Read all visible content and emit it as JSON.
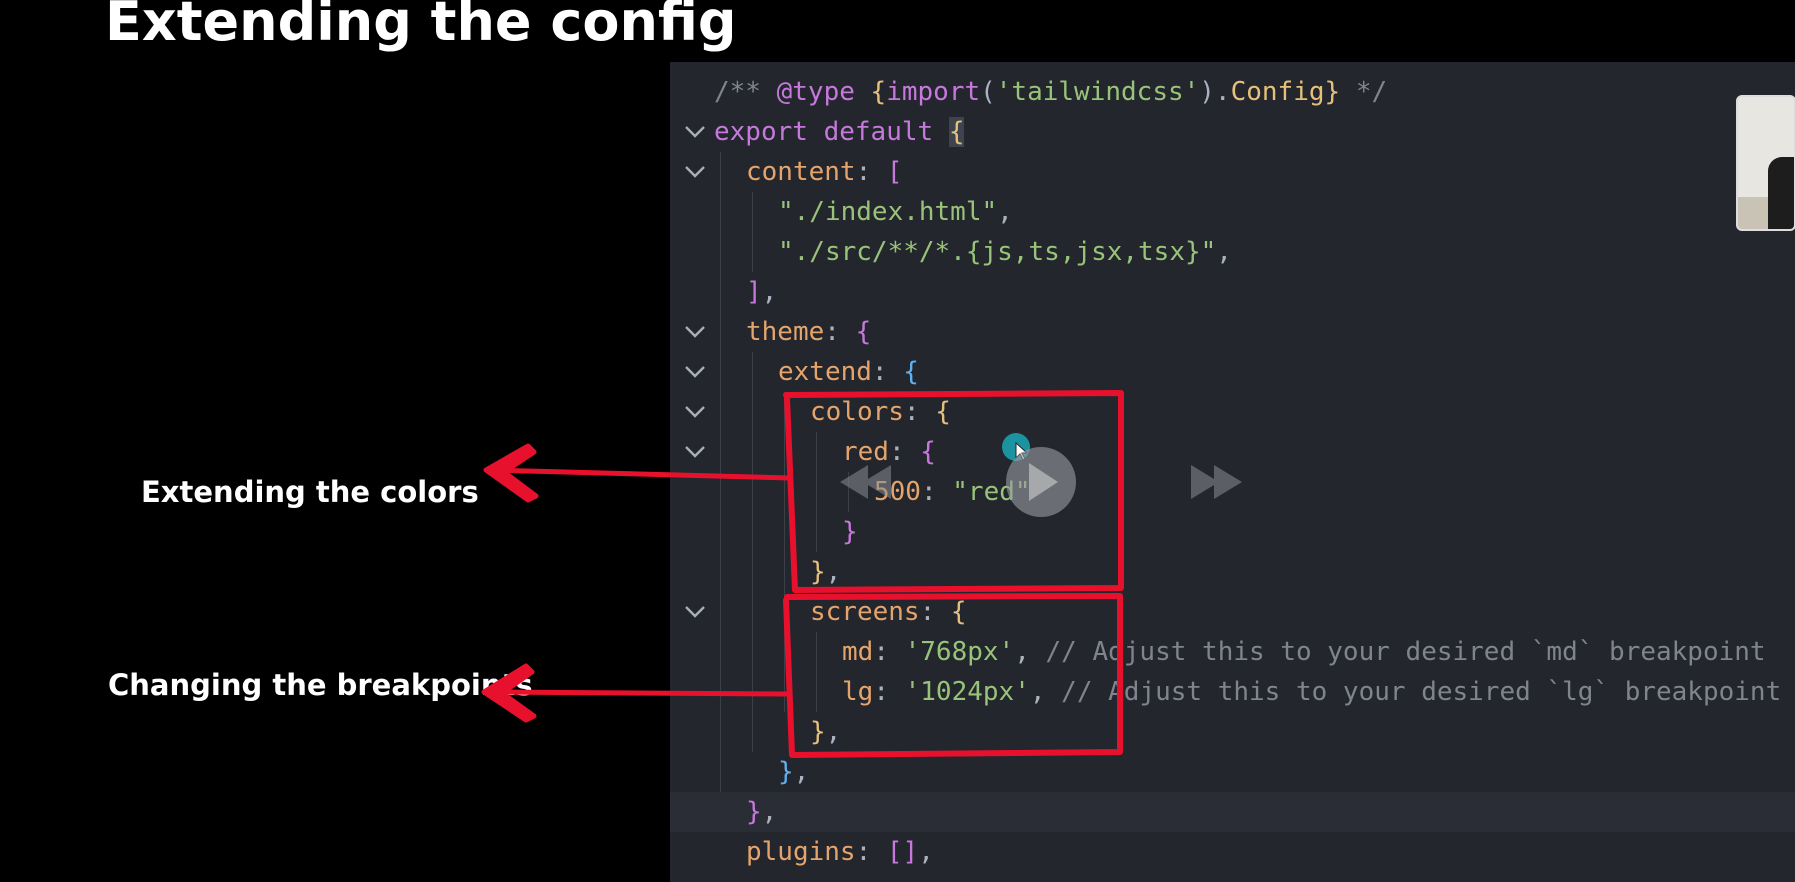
{
  "slide": {
    "title": "Extending the config",
    "annotations": {
      "colors": "Extending the colors",
      "breakpoints": "Changing the breakpoints"
    }
  },
  "editor": {
    "lines": [
      {
        "tokens": [
          {
            "t": "/** ",
            "c": "c-com"
          },
          {
            "t": "@type ",
            "c": "c-kw"
          },
          {
            "t": "{",
            "c": "c-brk-y"
          },
          {
            "t": "import",
            "c": "c-kw"
          },
          {
            "t": "(",
            "c": "c-pun"
          },
          {
            "t": "'tailwindcss'",
            "c": "c-str"
          },
          {
            "t": ").",
            "c": "c-pun"
          },
          {
            "t": "Config",
            "c": "c-fn"
          },
          {
            "t": "}",
            "c": "c-brk-y"
          },
          {
            "t": " */",
            "c": "c-com"
          }
        ]
      },
      {
        "fold": true,
        "tokens": [
          {
            "t": "export ",
            "c": "c-kw"
          },
          {
            "t": "default ",
            "c": "c-kw"
          },
          {
            "t": "{",
            "c": "c-brk-y brace-hl"
          }
        ]
      },
      {
        "fold": true,
        "tokens": [
          {
            "t": "content",
            "c": "c-key"
          },
          {
            "t": ": ",
            "c": "c-pun"
          },
          {
            "t": "[",
            "c": "c-brk-p"
          }
        ]
      },
      {
        "tokens": [
          {
            "t": "\"./index.html\"",
            "c": "c-str"
          },
          {
            "t": ",",
            "c": "c-pun"
          }
        ]
      },
      {
        "tokens": [
          {
            "t": "\"./src/**/*.{js,ts,jsx,tsx}\"",
            "c": "c-str"
          },
          {
            "t": ",",
            "c": "c-pun"
          }
        ]
      },
      {
        "tokens": [
          {
            "t": "]",
            "c": "c-brk-p"
          },
          {
            "t": ",",
            "c": "c-pun"
          }
        ]
      },
      {
        "fold": true,
        "tokens": [
          {
            "t": "theme",
            "c": "c-key"
          },
          {
            "t": ": ",
            "c": "c-pun"
          },
          {
            "t": "{",
            "c": "c-brk-p"
          }
        ]
      },
      {
        "fold": true,
        "tokens": [
          {
            "t": "extend",
            "c": "c-key"
          },
          {
            "t": ": ",
            "c": "c-pun"
          },
          {
            "t": "{",
            "c": "c-brk-b"
          }
        ]
      },
      {
        "fold": true,
        "tokens": [
          {
            "t": "colors",
            "c": "c-key"
          },
          {
            "t": ": ",
            "c": "c-pun"
          },
          {
            "t": "{",
            "c": "c-brk-y"
          }
        ]
      },
      {
        "fold": true,
        "tokens": [
          {
            "t": "red",
            "c": "c-key"
          },
          {
            "t": ": ",
            "c": "c-pun"
          },
          {
            "t": "{",
            "c": "c-brk-p"
          }
        ]
      },
      {
        "tokens": [
          {
            "t": "500",
            "c": "c-key"
          },
          {
            "t": ": ",
            "c": "c-pun"
          },
          {
            "t": "\"red\"",
            "c": "c-str"
          }
        ]
      },
      {
        "tokens": [
          {
            "t": "}",
            "c": "c-brk-p"
          }
        ]
      },
      {
        "tokens": [
          {
            "t": "}",
            "c": "c-brk-y"
          },
          {
            "t": ",",
            "c": "c-pun"
          }
        ]
      },
      {
        "fold": true,
        "tokens": [
          {
            "t": "screens",
            "c": "c-key"
          },
          {
            "t": ": ",
            "c": "c-pun"
          },
          {
            "t": "{",
            "c": "c-brk-y"
          }
        ]
      },
      {
        "tokens": [
          {
            "t": "md",
            "c": "c-key"
          },
          {
            "t": ": ",
            "c": "c-pun"
          },
          {
            "t": "'768px'",
            "c": "c-str"
          },
          {
            "t": ", ",
            "c": "c-pun"
          },
          {
            "t": "// Adjust this to your desired `md` breakpoint",
            "c": "c-com"
          }
        ]
      },
      {
        "tokens": [
          {
            "t": "lg",
            "c": "c-key"
          },
          {
            "t": ": ",
            "c": "c-pun"
          },
          {
            "t": "'1024px'",
            "c": "c-str"
          },
          {
            "t": ", ",
            "c": "c-pun"
          },
          {
            "t": "// Adjust this to your desired `lg` breakpoint",
            "c": "c-com"
          }
        ]
      },
      {
        "tokens": [
          {
            "t": "}",
            "c": "c-brk-y"
          },
          {
            "t": ",",
            "c": "c-pun"
          }
        ]
      },
      {
        "tokens": [
          {
            "t": "}",
            "c": "c-brk-b"
          },
          {
            "t": ",",
            "c": "c-pun"
          }
        ]
      },
      {
        "current": true,
        "tokens": [
          {
            "t": "}",
            "c": "c-brk-p"
          },
          {
            "t": ",",
            "c": "c-pun"
          }
        ]
      },
      {
        "tokens": [
          {
            "t": "plugins",
            "c": "c-key"
          },
          {
            "t": ": ",
            "c": "c-pun"
          },
          {
            "t": "[]",
            "c": "c-brk-p"
          },
          {
            "t": ",",
            "c": "c-pun"
          }
        ]
      }
    ]
  },
  "colors": {
    "annotation_red": "#e8112d",
    "editor_bg": "#23262d",
    "cursor_dot": "#1aa7b5"
  },
  "player": {
    "icons": [
      "rewind-icon",
      "play-icon",
      "fast-forward-icon"
    ]
  }
}
